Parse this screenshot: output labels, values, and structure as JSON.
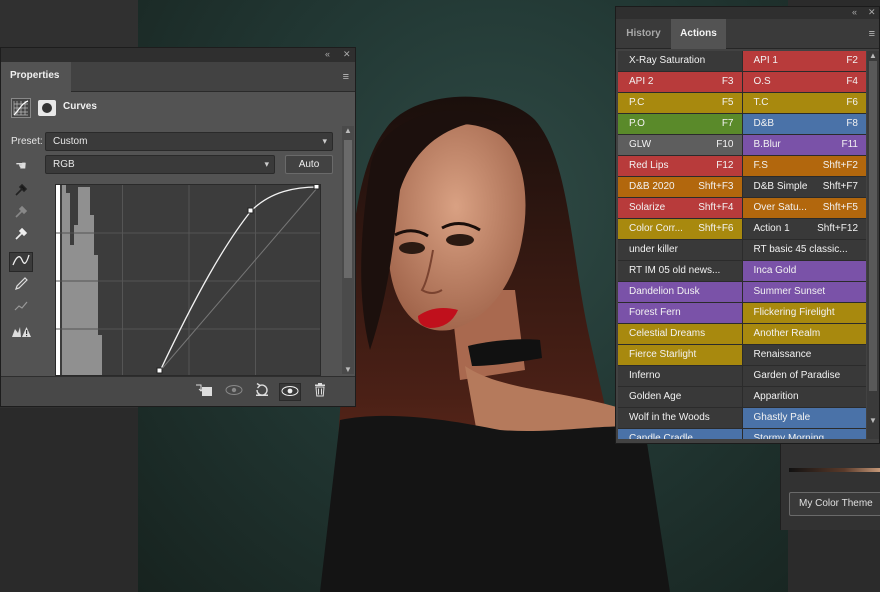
{
  "properties_panel": {
    "tab": "Properties",
    "adjustment_title": "Curves",
    "preset_label": "Preset:",
    "preset_value": "Custom",
    "channel_value": "RGB",
    "auto_label": "Auto",
    "icons": {
      "collapse": "«",
      "close": "✕",
      "menu": "≡"
    }
  },
  "actions_panel": {
    "tabs": [
      {
        "label": "History",
        "active": false
      },
      {
        "label": "Actions",
        "active": true
      }
    ],
    "icons": {
      "collapse": "«",
      "close": "✕",
      "menu": "≡"
    },
    "buttons": [
      {
        "name": "X-Ray Saturation",
        "key": "",
        "color": "none"
      },
      {
        "name": "API 1",
        "key": "F2",
        "color": "red"
      },
      {
        "name": "API 2",
        "key": "F3",
        "color": "red"
      },
      {
        "name": "O.S",
        "key": "F4",
        "color": "red"
      },
      {
        "name": "P.C",
        "key": "F5",
        "color": "yellow"
      },
      {
        "name": "T.C",
        "key": "F6",
        "color": "yellow"
      },
      {
        "name": "P.O",
        "key": "F7",
        "color": "green"
      },
      {
        "name": "D&B",
        "key": "F8",
        "color": "blue"
      },
      {
        "name": "GLW",
        "key": "F10",
        "color": "gray"
      },
      {
        "name": "B.Blur",
        "key": "F11",
        "color": "purple"
      },
      {
        "name": "Red Lips",
        "key": "F12",
        "color": "red"
      },
      {
        "name": "F.S",
        "key": "Shft+F2",
        "color": "orange"
      },
      {
        "name": "D&B 2020",
        "key": "Shft+F3",
        "color": "orange"
      },
      {
        "name": "D&B Simple",
        "key": "Shft+F7",
        "color": "none"
      },
      {
        "name": "Solarize",
        "key": "Shft+F4",
        "color": "red"
      },
      {
        "name": "Over Satu...",
        "key": "Shft+F5",
        "color": "orange"
      },
      {
        "name": "Color Corr...",
        "key": "Shft+F6",
        "color": "yellow"
      },
      {
        "name": "Action 1",
        "key": "Shft+F12",
        "color": "none"
      },
      {
        "name": "under killer",
        "key": "",
        "color": "none"
      },
      {
        "name": "RT basic 45 classic...",
        "key": "",
        "color": "none"
      },
      {
        "name": "RT IM 05 old news...",
        "key": "",
        "color": "none"
      },
      {
        "name": "Inca Gold",
        "key": "",
        "color": "purple"
      },
      {
        "name": "Dandelion Dusk",
        "key": "",
        "color": "purple"
      },
      {
        "name": "Summer Sunset",
        "key": "",
        "color": "purple"
      },
      {
        "name": "Forest Fern",
        "key": "",
        "color": "purple"
      },
      {
        "name": "Flickering Firelight",
        "key": "",
        "color": "yellow"
      },
      {
        "name": "Celestial Dreams",
        "key": "",
        "color": "yellow"
      },
      {
        "name": "Another Realm",
        "key": "",
        "color": "yellow"
      },
      {
        "name": "Fierce Starlight",
        "key": "",
        "color": "yellow"
      },
      {
        "name": "Renaissance",
        "key": "",
        "color": "none"
      },
      {
        "name": "Inferno",
        "key": "",
        "color": "none"
      },
      {
        "name": "Garden of Paradise",
        "key": "",
        "color": "none"
      },
      {
        "name": "Golden Age",
        "key": "",
        "color": "none"
      },
      {
        "name": "Apparition",
        "key": "",
        "color": "none"
      },
      {
        "name": "Wolf in the Woods",
        "key": "",
        "color": "none"
      },
      {
        "name": "Ghastly Pale",
        "key": "",
        "color": "blue"
      },
      {
        "name": "Candle Cradle",
        "key": "",
        "color": "blue"
      },
      {
        "name": "Stormy Morning",
        "key": "",
        "color": "blue"
      }
    ]
  },
  "background_panel": {
    "theme_button": "My Color Theme"
  },
  "colors": {
    "panel_bg": "#535353",
    "panel_dark": "#424242",
    "canvas_teal": "#223834"
  }
}
